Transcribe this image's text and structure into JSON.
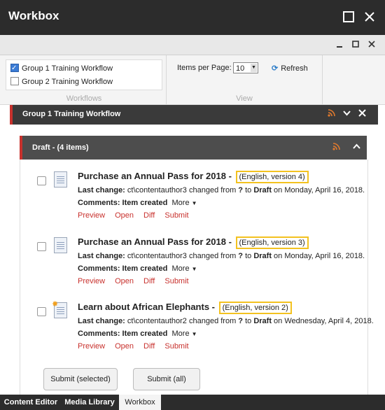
{
  "window": {
    "title": "Workbox"
  },
  "ribbon": {
    "workflows": [
      {
        "label": "Group 1 Training Workflow",
        "checked": true
      },
      {
        "label": "Group 2 Training Workflow",
        "checked": false
      }
    ],
    "workflows_group_label": "Workflows",
    "items_per_page_label": "Items per Page:",
    "items_per_page_value": "10",
    "refresh_label": "Refresh",
    "view_group_label": "View"
  },
  "workflow": {
    "title": "Group 1 Training Workflow",
    "state": {
      "title": "Draft - (4 items)",
      "items": [
        {
          "title": "Purchase an Annual Pass for 2018",
          "dash": " - ",
          "version": "(English, version 4)",
          "last_change_label": "Last change:",
          "last_change_text": " ct\\contentauthor3 changed from ",
          "from": "?",
          "to_text": " to ",
          "to": "Draft",
          "date_text": " on Monday, April 16, 2018.",
          "comments_label": "Comments: Item created",
          "more": "More",
          "actions": [
            "Preview",
            "Open",
            "Diff",
            "Submit"
          ]
        },
        {
          "title": "Purchase an Annual Pass for 2018",
          "dash": " - ",
          "version": "(English, version 3)",
          "last_change_label": "Last change:",
          "last_change_text": " ct\\contentauthor3 changed from ",
          "from": "?",
          "to_text": " to ",
          "to": "Draft",
          "date_text": " on Monday, April 16, 2018.",
          "comments_label": "Comments: Item created",
          "more": "More",
          "actions": [
            "Preview",
            "Open",
            "Diff",
            "Submit"
          ]
        },
        {
          "title": "Learn about African Elephants",
          "dash": " - ",
          "version": "(English, version 2)",
          "last_change_label": "Last change:",
          "last_change_text": " ct\\contentauthor2 changed from ",
          "from": "?",
          "to_text": " to ",
          "to": "Draft",
          "date_text": " on Wednesday, April 4, 2018.",
          "comments_label": "Comments: Item created",
          "more": "More",
          "actions": [
            "Preview",
            "Open",
            "Diff",
            "Submit"
          ]
        }
      ],
      "submit_selected": "Submit (selected)",
      "submit_all": "Submit (all)"
    }
  },
  "taskbar": {
    "tabs": [
      {
        "label": "Content Editor",
        "active": false
      },
      {
        "label": "Media Library",
        "active": false
      },
      {
        "label": "Workbox",
        "active": true
      }
    ]
  }
}
